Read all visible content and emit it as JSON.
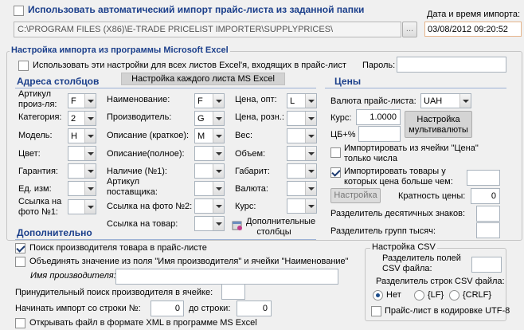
{
  "auto_import": {
    "label": "Использовать автоматический импорт прайс-листа из заданной папки",
    "checked": false,
    "path": "C:\\PROGRAM FILES (X86)\\E-TRADE PRICELIST IMPORTER\\SUPPLYPRICES\\",
    "browse_label": "..."
  },
  "import_datetime": {
    "label": "Дата и время импорта:",
    "value": "03/08/2012 09:20:52"
  },
  "excel_settings": {
    "title": "Настройка импорта из программы Microsoft Excel",
    "use_for_all_sheets": "Использовать эти настройки для всех листов Excel'я, входящих в прайс-лист",
    "password_label": "Пароль:",
    "password_value": "",
    "per_sheet_tab": "Настройка каждого листа MS Excel"
  },
  "columns": {
    "title": "Адреса столбцов",
    "col1": [
      {
        "label": "Артикул произ-ля:",
        "value": "F"
      },
      {
        "label": "Категория:",
        "value": "2"
      },
      {
        "label": "Модель:",
        "value": "H"
      },
      {
        "label": "Цвет:",
        "value": ""
      },
      {
        "label": "Гарантия:",
        "value": ""
      },
      {
        "label": "Ед. изм:",
        "value": ""
      },
      {
        "label": "Ссылка на фото №1:",
        "value": ""
      }
    ],
    "col2": [
      {
        "label": "Наименование:",
        "value": "F"
      },
      {
        "label": "Производитель:",
        "value": "G"
      },
      {
        "label": "Описание (краткое):",
        "value": "M"
      },
      {
        "label": "Описание(полное):",
        "value": ""
      },
      {
        "label": "Наличие (№1):",
        "value": ""
      },
      {
        "label": "Артикул поставщика:",
        "value": ""
      },
      {
        "label": "Ссылка на фото №2:",
        "value": ""
      },
      {
        "label": "Ссылка на товар:",
        "value": ""
      }
    ],
    "col3": [
      {
        "label": "Цена, опт:",
        "value": "L"
      },
      {
        "label": "Цена, розн.:",
        "value": ""
      },
      {
        "label": "Вес:",
        "value": ""
      },
      {
        "label": "Объем:",
        "value": ""
      },
      {
        "label": "Габарит:",
        "value": ""
      },
      {
        "label": "Валюта:",
        "value": ""
      },
      {
        "label": "Курс:",
        "value": ""
      }
    ],
    "extra_columns_label": "Дополнительные столбцы"
  },
  "prices": {
    "title": "Цены",
    "currency_label": "Валюта прайс-листа:",
    "currency_value": "UAH",
    "rate_label": "Курс:",
    "rate_value": "1.0000",
    "cb_label": "ЦБ+%",
    "cb_value": "",
    "multicurrency_button": "Настройка мультивалюты",
    "import_from_price_cell": "Импортировать из ячейки \"Цена\" только числа",
    "import_goods_price_gt": "Импортировать товары у которых цена больше чем:",
    "import_goods_price_gt_value": "",
    "setup_button": "Настройка",
    "multiplicity_label": "Кратность цены:",
    "multiplicity_value": "0",
    "decimal_sep_label": "Разделитель десятичных знаков:",
    "decimal_sep_value": "",
    "group_sep_label": "Разделитель групп тысяч:",
    "group_sep_value": ""
  },
  "extra": {
    "title": "Дополнительно",
    "search_manufacturer": "Поиск производителя товара в прайс-листе",
    "merge_values": "Объединять значение из поля \"Имя производителя\" и ячейки \"Наименование\"",
    "manufacturer_name_label": "Имя производителя:",
    "manufacturer_name_value": "",
    "forced_search_label": "Принудительный поиск производителя в ячейке:",
    "forced_search_value": "",
    "start_row_label": "Начинать импорт со строки №:",
    "start_row_value": "0",
    "end_row_label": "до строки:",
    "end_row_value": "0",
    "open_xml": "Открывать файл в формате XML в программе MS Excel"
  },
  "csv": {
    "title": "Настройка CSV",
    "field_sep_label": "Разделитель полей CSV файла:",
    "field_sep_value": "",
    "row_sep_label": "Разделитель строк CSV файла:",
    "options": [
      "Нет",
      "{LF}",
      "{CRLF}"
    ],
    "selected": "Нет",
    "utf8_label": "Прайс-лист в кодировке UTF-8"
  }
}
